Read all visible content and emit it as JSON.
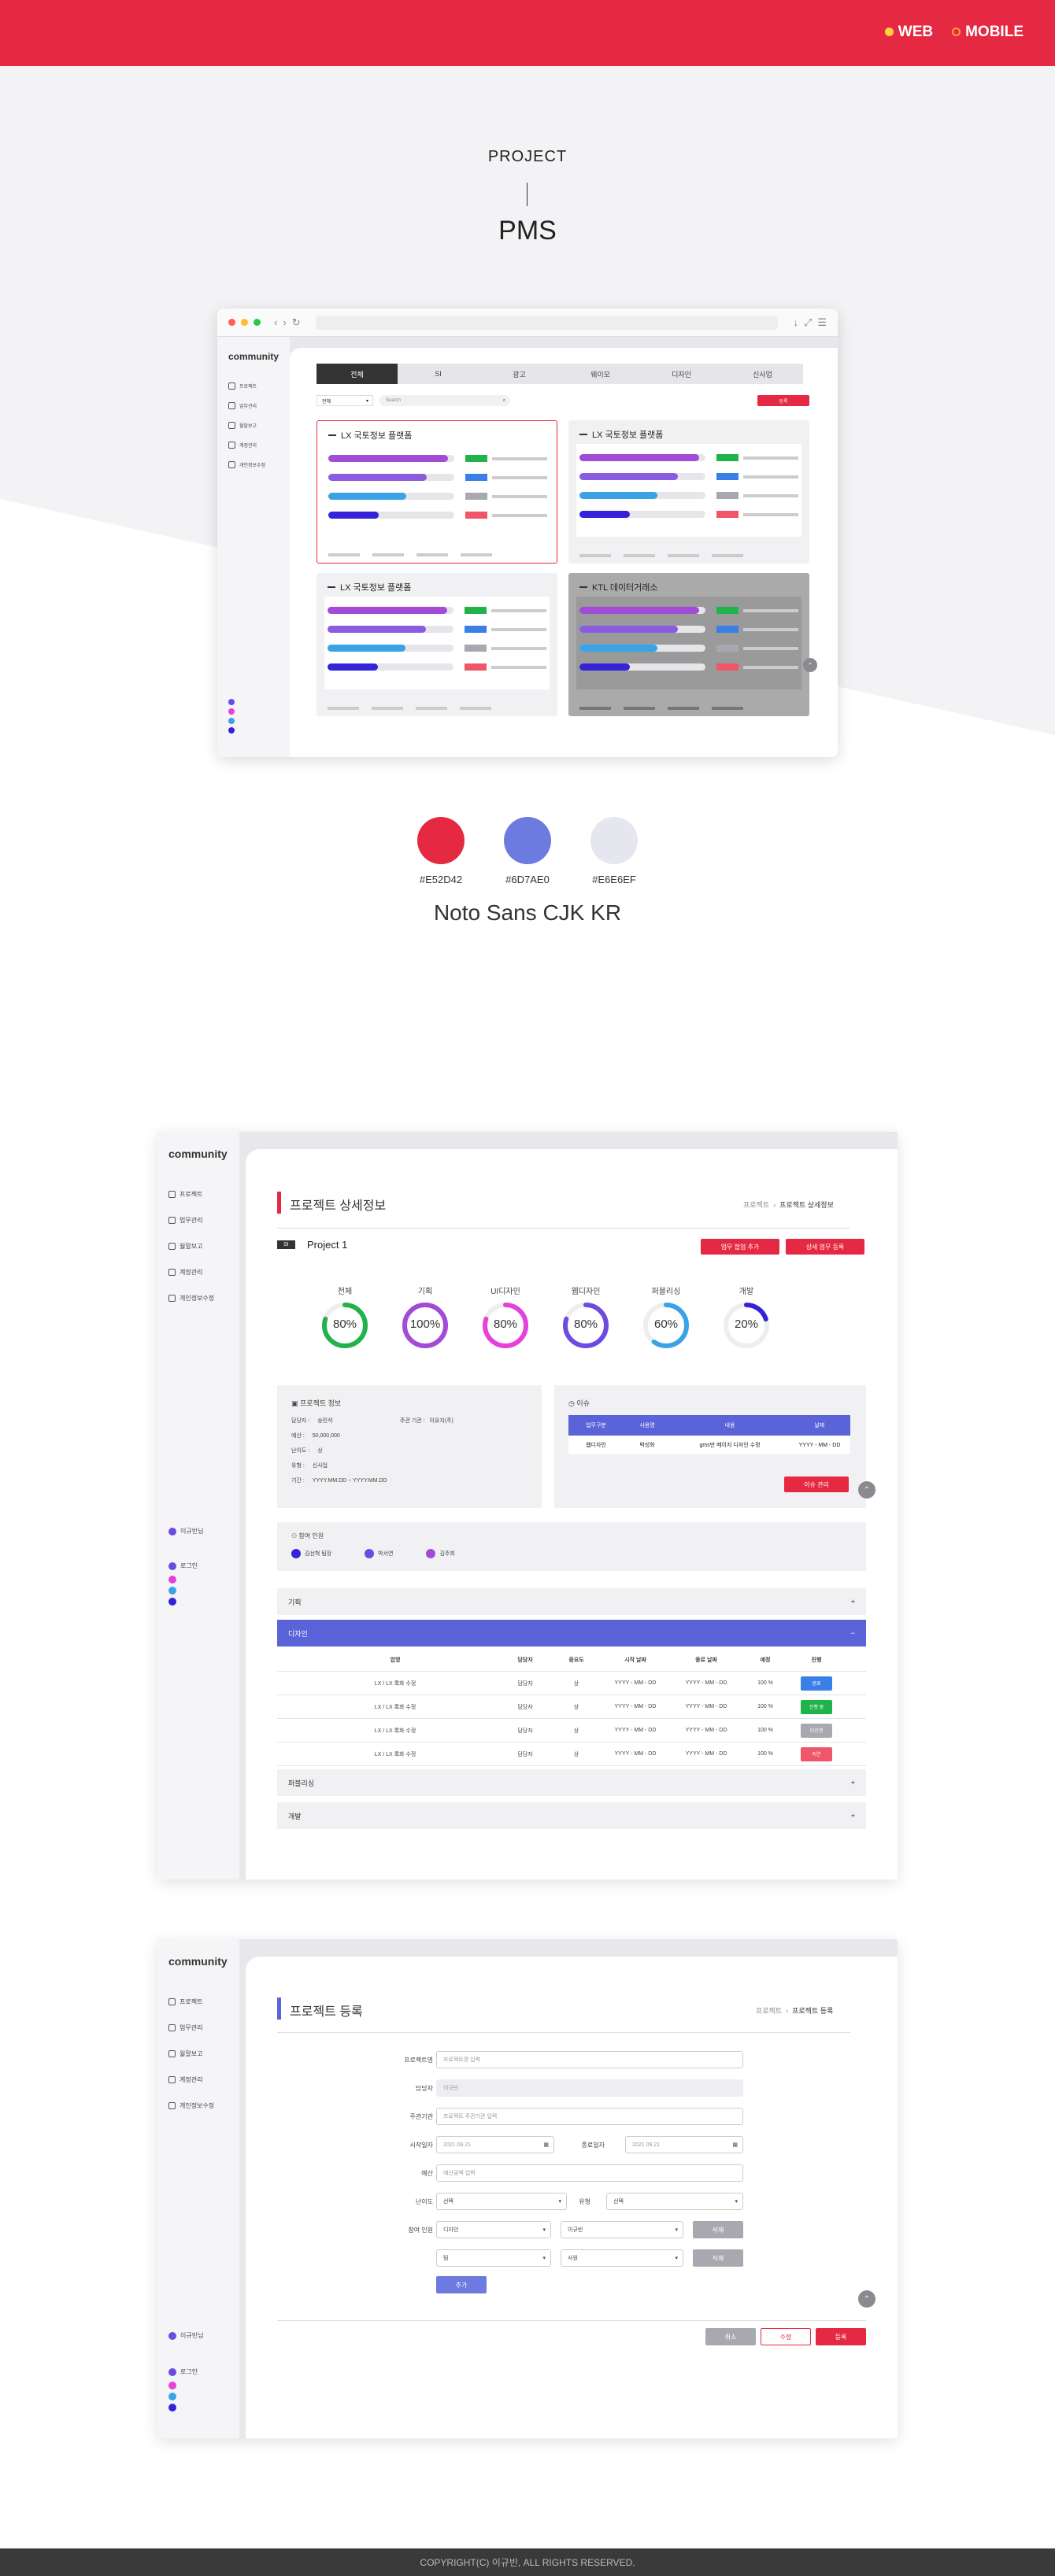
{
  "header": {
    "web_label": "WEB",
    "mobile_label": "MOBILE",
    "web_dot_color": "#ffd43b",
    "mobile_dot_color": "#ff9a3c",
    "bg": "#e52942"
  },
  "hero": {
    "project_label": "PROJECT",
    "project_title": "PMS"
  },
  "palette": [
    {
      "hex": "#E52D42",
      "color": "#e52942"
    },
    {
      "hex": "#6D7AE0",
      "color": "#6d7ae0"
    },
    {
      "hex": "#E6E6EF",
      "color": "#e6e6ef"
    }
  ],
  "font_name": "Noto Sans CJK KR",
  "mockup1": {
    "tabs": [
      "전체",
      "SI",
      "광고",
      "웨이모",
      "디자인",
      "신사업"
    ],
    "filter_select": "전체",
    "search_placeholder": "Search",
    "register_button": "등록",
    "sidebar_items": [
      "프로젝트",
      "업무관리",
      "월말보고",
      "계정관리",
      "개인정보수정"
    ],
    "cards": [
      {
        "title": "LX 국토정보 플랫폼"
      },
      {
        "title": "LX 국토정보 플랫폼"
      },
      {
        "title": "LX 국토정보 플랫폼"
      },
      {
        "title": "KTL 데이터거래소"
      }
    ]
  },
  "detail": {
    "sidebar_items": [
      "프로젝트",
      "업무관리",
      "월말보고",
      "계정관리",
      "개인정보수정"
    ],
    "logo": "community",
    "user_label": "이규빈님",
    "logout_label": "로그인",
    "page_title": "프로젝트 상세정보",
    "breadcrumb": [
      "프로젝트",
      "프로젝트 상세정보"
    ],
    "project_tag": "SI",
    "project_name": "Project 1",
    "btn_add_work": "업무 협업 추가",
    "btn_detail_register": "상세 업무 등록",
    "gauges": [
      {
        "label": "전체",
        "value": 80,
        "text": "80%",
        "color": "#21b24b"
      },
      {
        "label": "기획",
        "value": 100,
        "text": "100%",
        "color": "#a24bd6"
      },
      {
        "label": "UI디자인",
        "value": 80,
        "text": "80%",
        "color": "#e442d9"
      },
      {
        "label": "웹디자인",
        "value": 80,
        "text": "80%",
        "color": "#6d4be0"
      },
      {
        "label": "퍼블리싱",
        "value": 60,
        "text": "60%",
        "color": "#3aa3e6"
      },
      {
        "label": "개발",
        "value": 20,
        "text": "20%",
        "color": "#3423d9"
      }
    ],
    "info_title": "프로젝트 정보",
    "info_rows": [
      {
        "k": "담당자 :",
        "v": "송민석"
      },
      {
        "k": "예산 :",
        "v": "50,000,000"
      },
      {
        "k": "난이도 :",
        "v": "상"
      },
      {
        "k": "유형 :",
        "v": "신사업"
      },
      {
        "k": "기간 :",
        "v": "YYYY.MM.DD ~ YYYY.MM.DD"
      }
    ],
    "info_extra": {
      "k": "주관 기관 :",
      "v": "이유지(주)"
    },
    "issue_title": "이슈",
    "issue_headers": [
      "업무구분",
      "사용명",
      "내용",
      "날짜"
    ],
    "issue_row": [
      "웹디자인",
      "박성화",
      "gms만 메이지 디자인 수정",
      "YYYY - MM - DD"
    ],
    "issue_button": "이슈 관리",
    "members_title": "참여 인원",
    "members": [
      "김선혁 팀장",
      "박서연",
      "김주희"
    ],
    "accordion": [
      "기획",
      "디자인",
      "퍼블리싱",
      "개발"
    ],
    "table_headers": [
      "업명",
      "담당자",
      "중요도",
      "시작 날짜",
      "종료 날짜",
      "예정",
      "진행"
    ],
    "table_rows": [
      {
        "name": "LX / LX 록화 수정",
        "owner": "담당자",
        "pri": "상",
        "start": "YYYY - MM - DD",
        "end": "YYYY - MM - DD",
        "pct": "100 %",
        "status": "완료",
        "scolor": "#3a7fe8"
      },
      {
        "name": "LX / LX 록화 수정",
        "owner": "담당자",
        "pri": "상",
        "start": "YYYY - MM - DD",
        "end": "YYYY - MM - DD",
        "pct": "100 %",
        "status": "진행 중",
        "scolor": "#20b34a"
      },
      {
        "name": "LX / LX 록화 수정",
        "owner": "담당자",
        "pri": "상",
        "start": "YYYY - MM - DD",
        "end": "YYYY - MM - DD",
        "pct": "100 %",
        "status": "미진행",
        "scolor": "#a8a8b0"
      },
      {
        "name": "LX / LX 록화 수정",
        "owner": "담당자",
        "pri": "상",
        "start": "YYYY - MM - DD",
        "end": "YYYY - MM - DD",
        "pct": "100 %",
        "status": "지연",
        "scolor": "#f0566a"
      }
    ]
  },
  "form": {
    "page_title": "프로젝트 등록",
    "breadcrumb": [
      "프로젝트",
      "프로젝트 등록"
    ],
    "labels": {
      "name": "프로젝트명",
      "owner": "담당자",
      "org": "주관기관",
      "start": "시작일자",
      "end": "종료일자",
      "budget": "예산",
      "difficulty": "난이도",
      "type": "유형",
      "members": "참여 인원"
    },
    "placeholders": {
      "name": "프로젝트명 입력",
      "owner": "이규빈",
      "org": "프로젝트 주관기관 입력",
      "start": "2021.09.21",
      "end": "2021.09.21",
      "budget": "예산금액 입력"
    },
    "selects": {
      "difficulty": "선택",
      "type": "선택",
      "team1": "디자인",
      "person1": "이규빈",
      "team2": "팀",
      "person2": "사원"
    },
    "delete_label": "삭제",
    "add_label": "추가",
    "cancel_label": "취소",
    "edit_label": "수정",
    "submit_label": "등록"
  },
  "footer": {
    "copyright": "COPYRIGHT(C) 이규빈, ALL RIGHTS RESERVED."
  }
}
